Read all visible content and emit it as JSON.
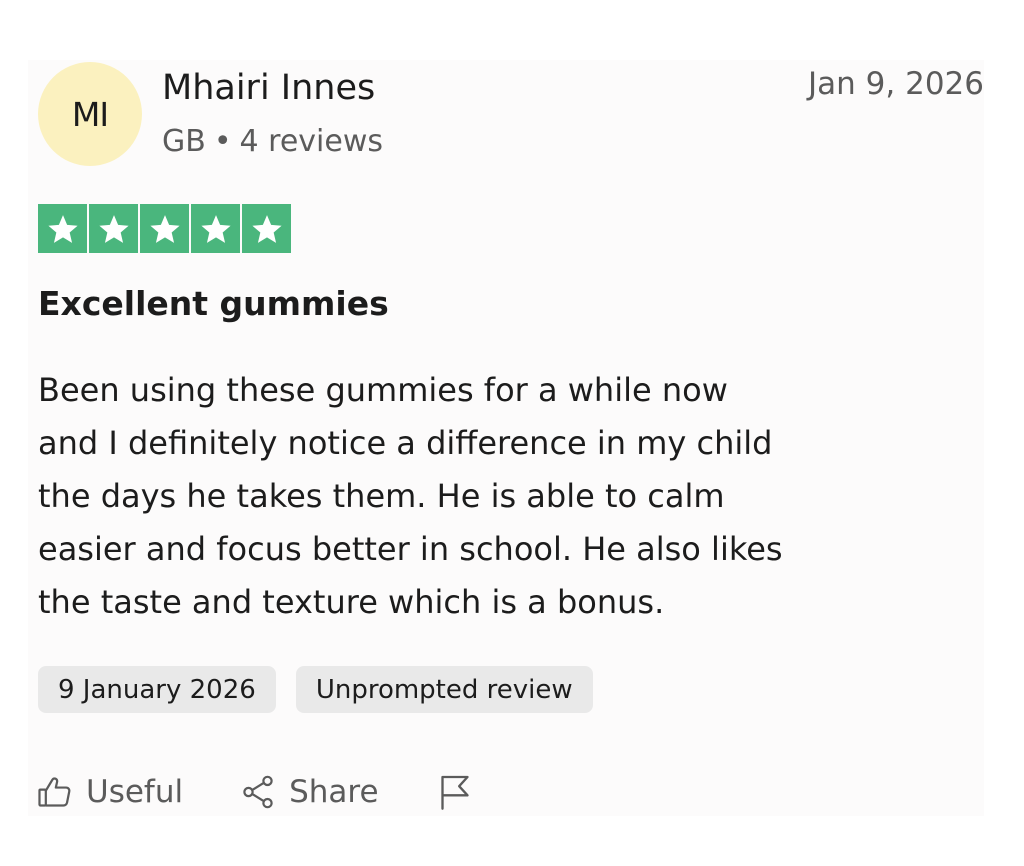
{
  "review": {
    "avatar_initials": "MI",
    "avatar_color": "#fbf1bf",
    "reviewer_name": "Mhairi Innes",
    "reviewer_country": "GB",
    "separator": "•",
    "reviewer_review_count": "4 reviews",
    "date_posted": "Jan 9, 2026",
    "rating": 5,
    "rating_max": 5,
    "star_color": "#4ab67d",
    "title": "Excellent gummies",
    "body_lines": [
      "Been using these gummies for a while now",
      "and I definitely notice a difference in my child",
      "the days he takes them. He is able to calm",
      "easier and focus better in school. He also likes",
      "the taste and texture which is a bonus."
    ],
    "chips": [
      "9 January 2026",
      "Unprompted review"
    ]
  },
  "actions": {
    "useful_label": "Useful",
    "useful_icon": "thumbs-up-icon",
    "share_label": "Share",
    "share_icon": "share-icon",
    "report_icon": "flag-icon"
  }
}
